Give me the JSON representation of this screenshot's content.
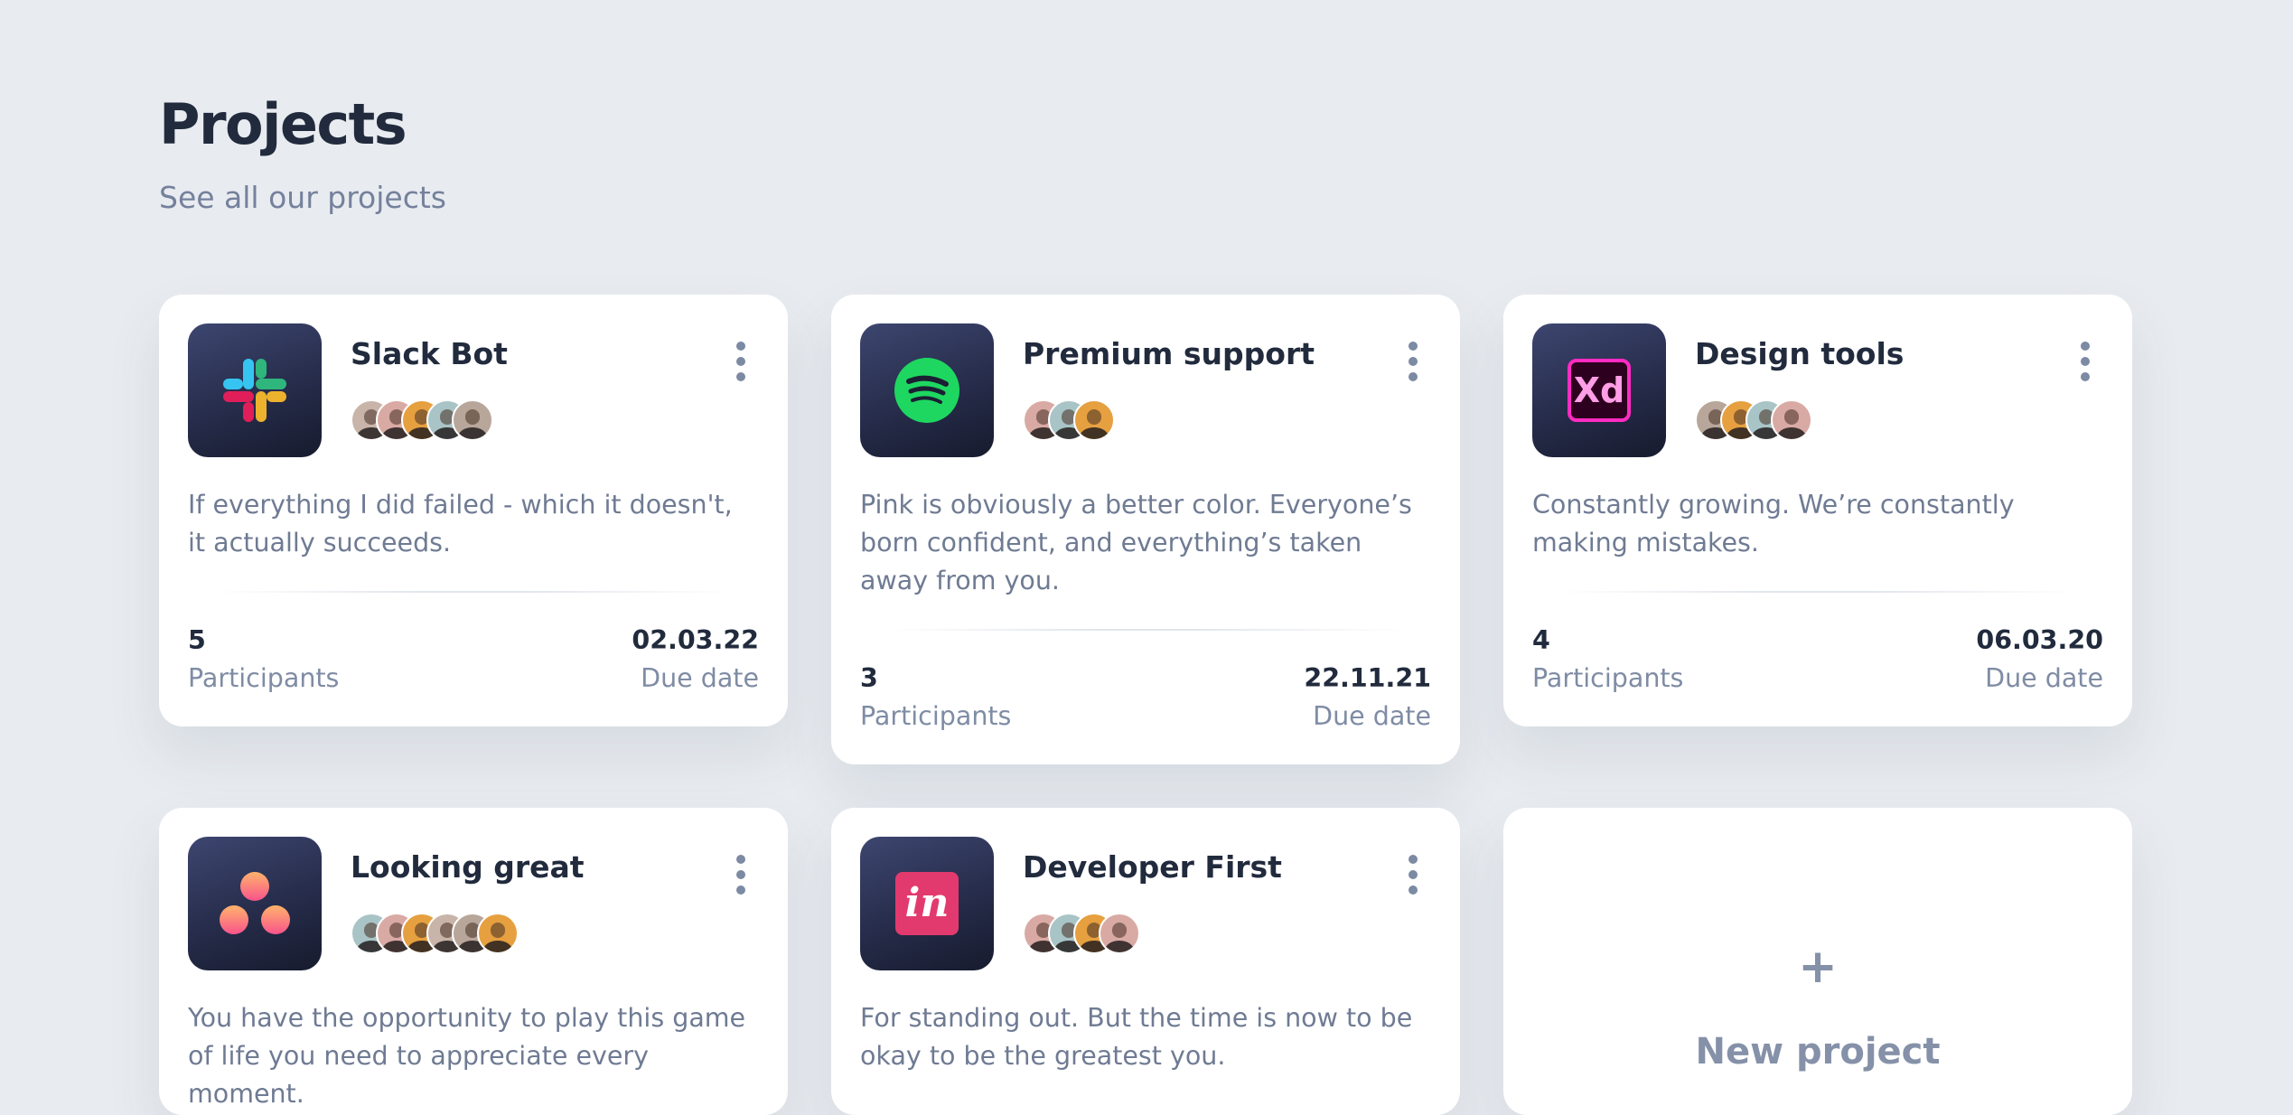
{
  "header": {
    "title": "Projects",
    "subtitle": "See all our projects"
  },
  "projects": [
    {
      "name": "Slack Bot",
      "icon": "slack-logo-icon",
      "description": "If everything I did failed - which it doesn't, it actually succeeds.",
      "participants_count": "5",
      "participants_label": "Participants",
      "due_date": "02.03.22",
      "due_date_label": "Due date"
    },
    {
      "name": "Premium support",
      "icon": "spotify-logo-icon",
      "description": "Pink is obviously a better color. Everyone’s born confident, and everything’s taken away from you.",
      "participants_count": "3",
      "participants_label": "Participants",
      "due_date": "22.11.21",
      "due_date_label": "Due date"
    },
    {
      "name": "Design tools",
      "icon": "adobe-xd-logo-icon",
      "icon_text": "Xd",
      "description": "Constantly growing. We’re constantly making mistakes.",
      "participants_count": "4",
      "participants_label": "Participants",
      "due_date": "06.03.20",
      "due_date_label": "Due date"
    },
    {
      "name": "Looking great",
      "icon": "asana-logo-icon",
      "description": "You have the opportunity to play this game of life you need to appreciate every moment."
    },
    {
      "name": "Developer First",
      "icon": "invision-logo-icon",
      "icon_text": "in",
      "description": "For standing out. But the time is now to be okay to be the greatest you."
    }
  ],
  "new_project": {
    "icon": "plus-icon",
    "plus_symbol": "+",
    "label": "New project"
  },
  "colors": {
    "background": "#e8ecf0",
    "card": "#ffffff",
    "title": "#212b3d",
    "muted": "#75819c",
    "icon_tile": "#262c4a"
  }
}
